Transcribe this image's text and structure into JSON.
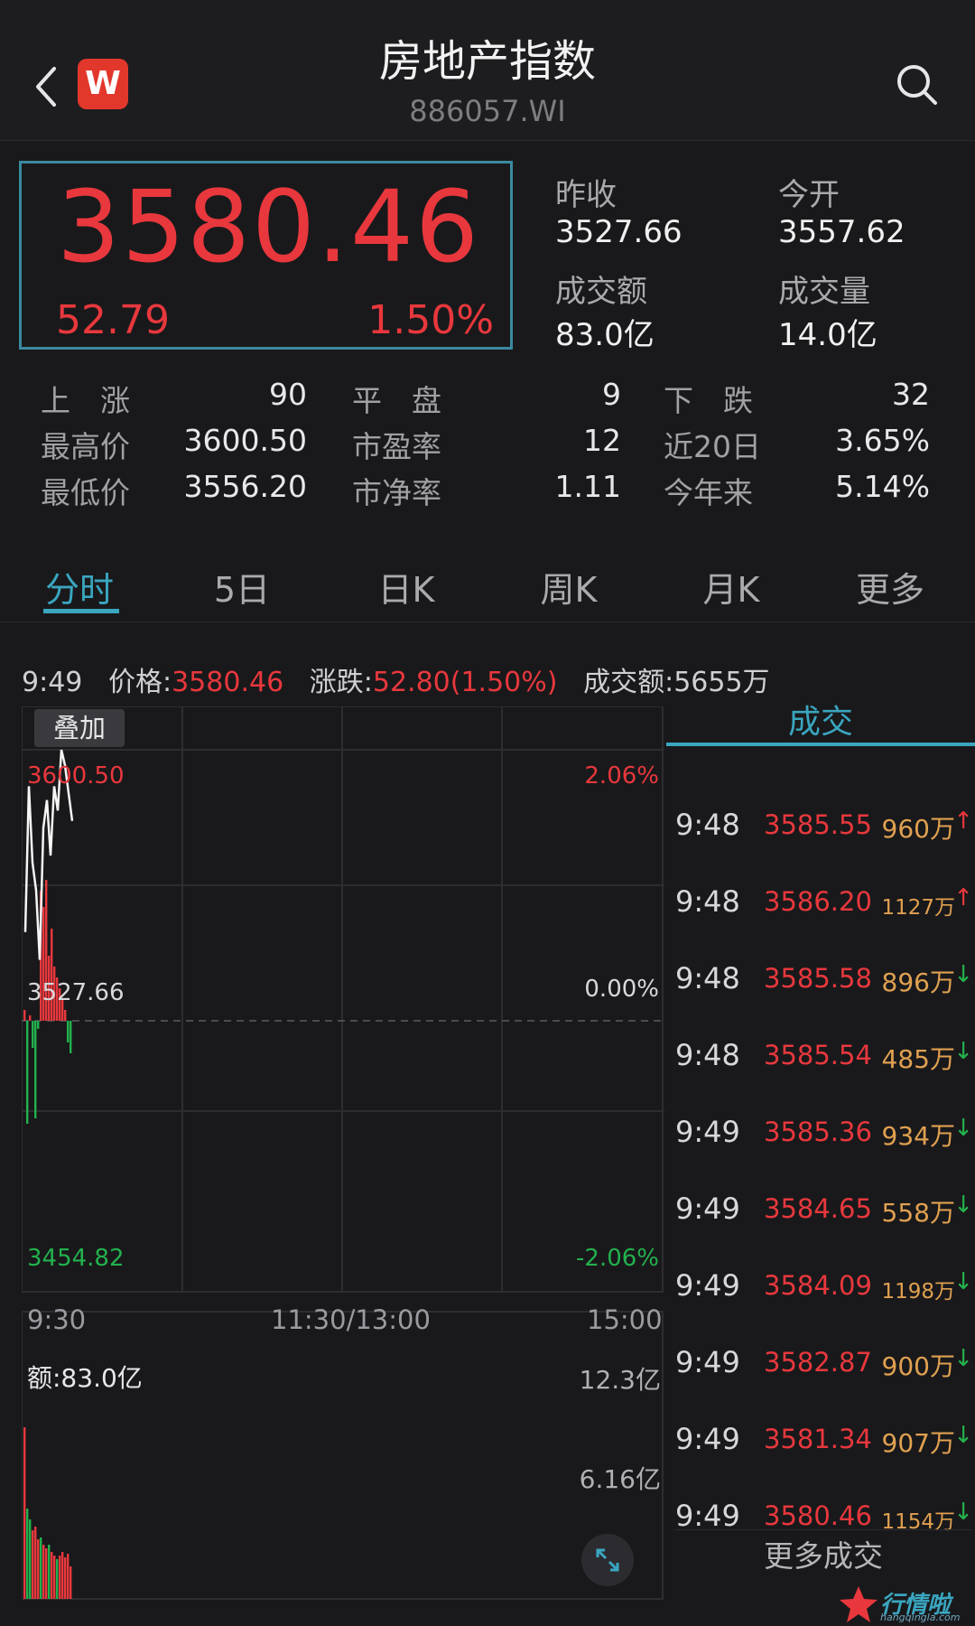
{
  "header": {
    "title": "房地产指数",
    "code": "886057.WI",
    "logo_letter": "W"
  },
  "quote": {
    "price": "3580.46",
    "change": "52.79",
    "change_pct": "1.50%",
    "prev_close_label": "昨收",
    "prev_close": "3527.66",
    "open_label": "今开",
    "open": "3557.62",
    "turnover_label": "成交额",
    "turnover": "83.0亿",
    "volume_label": "成交量",
    "volume": "14.0亿"
  },
  "stats": {
    "up_label": "上　涨",
    "up": "90",
    "flat_label": "平　盘",
    "flat": "9",
    "down_label": "下　跌",
    "down": "32",
    "high_label": "最高价",
    "high": "3600.50",
    "pe_label": "市盈率",
    "pe": "12",
    "d20_label": "近20日",
    "d20": "3.65%",
    "low_label": "最低价",
    "low": "3556.20",
    "pb_label": "市净率",
    "pb": "1.11",
    "ytd_label": "今年来",
    "ytd": "5.14%"
  },
  "tabs": [
    "分时",
    "5日",
    "日K",
    "周K",
    "月K",
    "更多"
  ],
  "info": {
    "time": "9:49",
    "price_label": "价格:",
    "price": "3580.46",
    "change_label": "涨跌:",
    "change": "52.80(1.50%)",
    "amount_label": "成交额:",
    "amount": "5655万"
  },
  "chart": {
    "overlay_label": "叠加",
    "y_top": "3600.50",
    "y_mid": "3527.66",
    "y_bottom": "3454.82",
    "pct_top": "2.06%",
    "pct_mid": "0.00%",
    "pct_bottom": "-2.06%",
    "x_start": "9:30",
    "x_mid": "11:30/13:00",
    "x_end": "15:00",
    "vol_label": "额:83.0亿",
    "vol_max": "12.3亿",
    "vol_half": "6.16亿"
  },
  "chart_data": {
    "type": "line",
    "ylim": [
      3454.82,
      3600.5
    ],
    "price_path": [
      3548,
      3590,
      3568,
      3560,
      3540,
      3578,
      3586,
      3570,
      3590,
      3583,
      3600.5,
      3596,
      3588,
      3580
    ],
    "price_bars": [
      {
        "v": 4,
        "c": "up"
      },
      {
        "v": 38,
        "c": "down"
      },
      {
        "v": 2,
        "c": "up"
      },
      {
        "v": 10,
        "c": "down"
      },
      {
        "v": 36,
        "c": "down"
      },
      {
        "v": 3,
        "c": "down"
      },
      {
        "v": 48,
        "c": "up"
      },
      {
        "v": 42,
        "c": "up"
      },
      {
        "v": 52,
        "c": "up"
      },
      {
        "v": 24,
        "c": "up"
      },
      {
        "v": 34,
        "c": "up"
      },
      {
        "v": 20,
        "c": "up"
      },
      {
        "v": 16,
        "c": "up"
      },
      {
        "v": 12,
        "c": "up"
      },
      {
        "v": 8,
        "c": "up"
      },
      {
        "v": 4,
        "c": "up"
      },
      {
        "v": 8,
        "c": "down"
      },
      {
        "v": 12,
        "c": "down"
      }
    ],
    "volume_bars": [
      {
        "v": 95,
        "c": "up"
      },
      {
        "v": 50,
        "c": "down"
      },
      {
        "v": 44,
        "c": "down"
      },
      {
        "v": 38,
        "c": "up"
      },
      {
        "v": 40,
        "c": "up"
      },
      {
        "v": 33,
        "c": "up"
      },
      {
        "v": 34,
        "c": "down"
      },
      {
        "v": 30,
        "c": "up"
      },
      {
        "v": 28,
        "c": "up"
      },
      {
        "v": 30,
        "c": "down"
      },
      {
        "v": 26,
        "c": "up"
      },
      {
        "v": 24,
        "c": "up"
      },
      {
        "v": 22,
        "c": "down"
      },
      {
        "v": 24,
        "c": "up"
      },
      {
        "v": 26,
        "c": "up"
      },
      {
        "v": 23,
        "c": "up"
      },
      {
        "v": 25,
        "c": "up"
      },
      {
        "v": 18,
        "c": "up"
      }
    ]
  },
  "trades": {
    "title": "成交",
    "rows": [
      {
        "time": "9:48",
        "price": "3585.55",
        "vol": "960万",
        "dir": "up"
      },
      {
        "time": "9:48",
        "price": "3586.20",
        "vol": "1127万",
        "dir": "up"
      },
      {
        "time": "9:48",
        "price": "3585.58",
        "vol": "896万",
        "dir": "down"
      },
      {
        "time": "9:48",
        "price": "3585.54",
        "vol": "485万",
        "dir": "down"
      },
      {
        "time": "9:49",
        "price": "3585.36",
        "vol": "934万",
        "dir": "down"
      },
      {
        "time": "9:49",
        "price": "3584.65",
        "vol": "558万",
        "dir": "down"
      },
      {
        "time": "9:49",
        "price": "3584.09",
        "vol": "1198万",
        "dir": "down"
      },
      {
        "time": "9:49",
        "price": "3582.87",
        "vol": "900万",
        "dir": "down"
      },
      {
        "time": "9:49",
        "price": "3581.34",
        "vol": "907万",
        "dir": "down"
      },
      {
        "time": "9:49",
        "price": "3580.46",
        "vol": "1154万",
        "dir": "down"
      }
    ],
    "more_label": "更多成交"
  },
  "watermark": {
    "text": "行情啦",
    "sub": "hangqingla.com"
  },
  "colors": {
    "up": "#e8383d",
    "down": "#23b14d",
    "accent": "#3aa6c0"
  }
}
